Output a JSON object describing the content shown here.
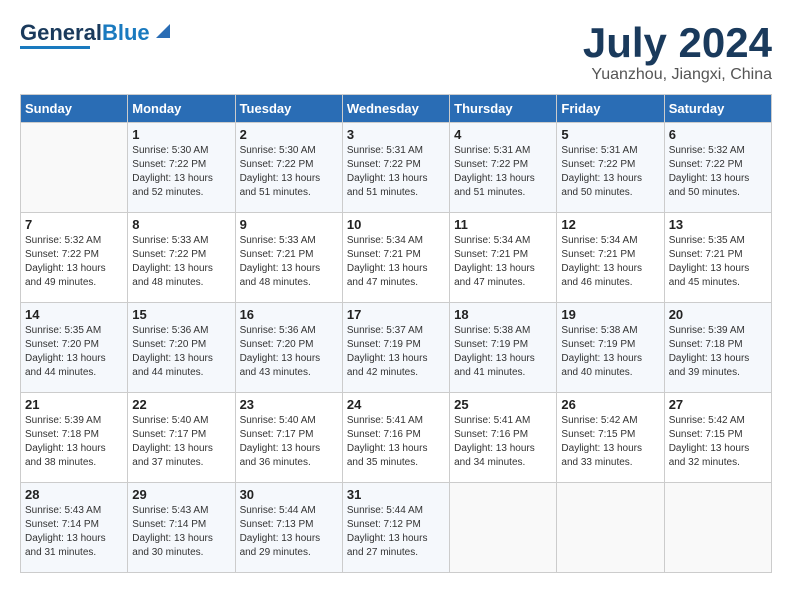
{
  "header": {
    "logo": {
      "part1": "General",
      "part2": "Blue"
    },
    "month": "July 2024",
    "location": "Yuanzhou, Jiangxi, China"
  },
  "columns": [
    "Sunday",
    "Monday",
    "Tuesday",
    "Wednesday",
    "Thursday",
    "Friday",
    "Saturday"
  ],
  "weeks": [
    [
      {
        "day": "",
        "info": ""
      },
      {
        "day": "1",
        "info": "Sunrise: 5:30 AM\nSunset: 7:22 PM\nDaylight: 13 hours\nand 52 minutes."
      },
      {
        "day": "2",
        "info": "Sunrise: 5:30 AM\nSunset: 7:22 PM\nDaylight: 13 hours\nand 51 minutes."
      },
      {
        "day": "3",
        "info": "Sunrise: 5:31 AM\nSunset: 7:22 PM\nDaylight: 13 hours\nand 51 minutes."
      },
      {
        "day": "4",
        "info": "Sunrise: 5:31 AM\nSunset: 7:22 PM\nDaylight: 13 hours\nand 51 minutes."
      },
      {
        "day": "5",
        "info": "Sunrise: 5:31 AM\nSunset: 7:22 PM\nDaylight: 13 hours\nand 50 minutes."
      },
      {
        "day": "6",
        "info": "Sunrise: 5:32 AM\nSunset: 7:22 PM\nDaylight: 13 hours\nand 50 minutes."
      }
    ],
    [
      {
        "day": "7",
        "info": "Sunrise: 5:32 AM\nSunset: 7:22 PM\nDaylight: 13 hours\nand 49 minutes."
      },
      {
        "day": "8",
        "info": "Sunrise: 5:33 AM\nSunset: 7:22 PM\nDaylight: 13 hours\nand 48 minutes."
      },
      {
        "day": "9",
        "info": "Sunrise: 5:33 AM\nSunset: 7:21 PM\nDaylight: 13 hours\nand 48 minutes."
      },
      {
        "day": "10",
        "info": "Sunrise: 5:34 AM\nSunset: 7:21 PM\nDaylight: 13 hours\nand 47 minutes."
      },
      {
        "day": "11",
        "info": "Sunrise: 5:34 AM\nSunset: 7:21 PM\nDaylight: 13 hours\nand 47 minutes."
      },
      {
        "day": "12",
        "info": "Sunrise: 5:34 AM\nSunset: 7:21 PM\nDaylight: 13 hours\nand 46 minutes."
      },
      {
        "day": "13",
        "info": "Sunrise: 5:35 AM\nSunset: 7:21 PM\nDaylight: 13 hours\nand 45 minutes."
      }
    ],
    [
      {
        "day": "14",
        "info": "Sunrise: 5:35 AM\nSunset: 7:20 PM\nDaylight: 13 hours\nand 44 minutes."
      },
      {
        "day": "15",
        "info": "Sunrise: 5:36 AM\nSunset: 7:20 PM\nDaylight: 13 hours\nand 44 minutes."
      },
      {
        "day": "16",
        "info": "Sunrise: 5:36 AM\nSunset: 7:20 PM\nDaylight: 13 hours\nand 43 minutes."
      },
      {
        "day": "17",
        "info": "Sunrise: 5:37 AM\nSunset: 7:19 PM\nDaylight: 13 hours\nand 42 minutes."
      },
      {
        "day": "18",
        "info": "Sunrise: 5:38 AM\nSunset: 7:19 PM\nDaylight: 13 hours\nand 41 minutes."
      },
      {
        "day": "19",
        "info": "Sunrise: 5:38 AM\nSunset: 7:19 PM\nDaylight: 13 hours\nand 40 minutes."
      },
      {
        "day": "20",
        "info": "Sunrise: 5:39 AM\nSunset: 7:18 PM\nDaylight: 13 hours\nand 39 minutes."
      }
    ],
    [
      {
        "day": "21",
        "info": "Sunrise: 5:39 AM\nSunset: 7:18 PM\nDaylight: 13 hours\nand 38 minutes."
      },
      {
        "day": "22",
        "info": "Sunrise: 5:40 AM\nSunset: 7:17 PM\nDaylight: 13 hours\nand 37 minutes."
      },
      {
        "day": "23",
        "info": "Sunrise: 5:40 AM\nSunset: 7:17 PM\nDaylight: 13 hours\nand 36 minutes."
      },
      {
        "day": "24",
        "info": "Sunrise: 5:41 AM\nSunset: 7:16 PM\nDaylight: 13 hours\nand 35 minutes."
      },
      {
        "day": "25",
        "info": "Sunrise: 5:41 AM\nSunset: 7:16 PM\nDaylight: 13 hours\nand 34 minutes."
      },
      {
        "day": "26",
        "info": "Sunrise: 5:42 AM\nSunset: 7:15 PM\nDaylight: 13 hours\nand 33 minutes."
      },
      {
        "day": "27",
        "info": "Sunrise: 5:42 AM\nSunset: 7:15 PM\nDaylight: 13 hours\nand 32 minutes."
      }
    ],
    [
      {
        "day": "28",
        "info": "Sunrise: 5:43 AM\nSunset: 7:14 PM\nDaylight: 13 hours\nand 31 minutes."
      },
      {
        "day": "29",
        "info": "Sunrise: 5:43 AM\nSunset: 7:14 PM\nDaylight: 13 hours\nand 30 minutes."
      },
      {
        "day": "30",
        "info": "Sunrise: 5:44 AM\nSunset: 7:13 PM\nDaylight: 13 hours\nand 29 minutes."
      },
      {
        "day": "31",
        "info": "Sunrise: 5:44 AM\nSunset: 7:12 PM\nDaylight: 13 hours\nand 27 minutes."
      },
      {
        "day": "",
        "info": ""
      },
      {
        "day": "",
        "info": ""
      },
      {
        "day": "",
        "info": ""
      }
    ]
  ]
}
